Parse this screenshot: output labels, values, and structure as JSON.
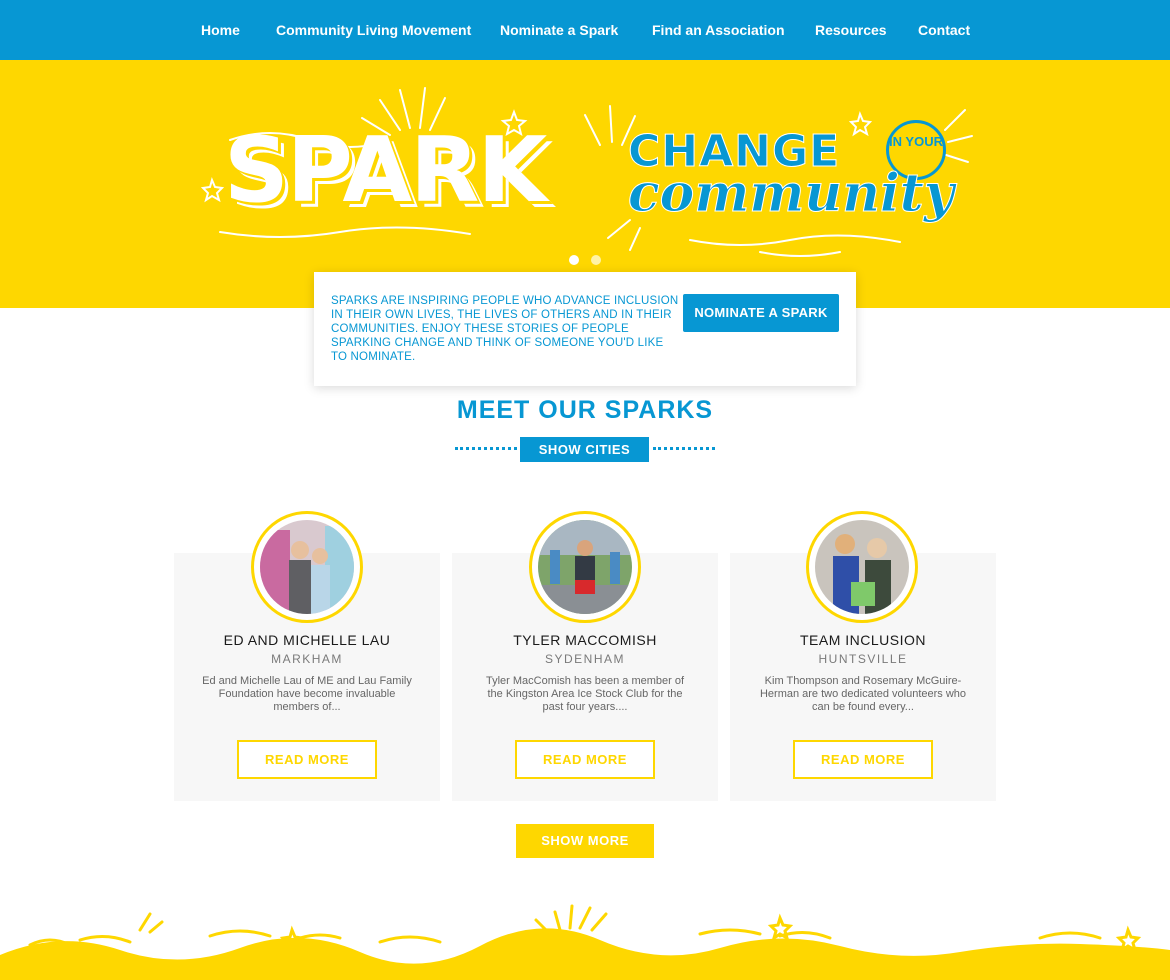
{
  "nav": {
    "items": [
      {
        "label": "Home"
      },
      {
        "label": "Community Living Movement"
      },
      {
        "label": "Nominate a Spark"
      },
      {
        "label": "Find an Association"
      },
      {
        "label": "Resources"
      },
      {
        "label": "Contact"
      }
    ]
  },
  "hero": {
    "spark": "SPARK",
    "change": "CHANGE",
    "in_your": "IN YOUR",
    "community": "community",
    "slide_count": 2,
    "active_slide": 1
  },
  "intro": {
    "text": "Sparks are inspiring people who advance inclusion in their own lives, the lives of others and in their communities. Enjoy these stories of people sparking change and think of someone you'd like to nominate.",
    "button": "NOMINATE A SPARK"
  },
  "sparks": {
    "title": "MEET OUR SPARKS",
    "show_cities": "SHOW CITIES",
    "cards": [
      {
        "name": "ED AND MICHELLE LAU",
        "city": "MARKHAM",
        "desc": "Ed and Michelle Lau of ME and Lau Family Foundation have become invaluable members of...",
        "button": "READ MORE"
      },
      {
        "name": "TYLER MACCOMISH",
        "city": "SYDENHAM",
        "desc": "Tyler MacComish has been a member of the Kingston Area Ice Stock Club for the past four years....",
        "button": "READ MORE"
      },
      {
        "name": "TEAM INCLUSION",
        "city": "HUNTSVILLE",
        "desc": "Kim Thompson and Rosemary McGuire-Herman are two dedicated volunteers who can be found every...",
        "button": "READ MORE"
      }
    ],
    "show_more": "SHOW MORE"
  },
  "colors": {
    "brand_blue": "#0797d3",
    "brand_yellow": "#fed700",
    "card_bg": "#f7f7f7"
  }
}
